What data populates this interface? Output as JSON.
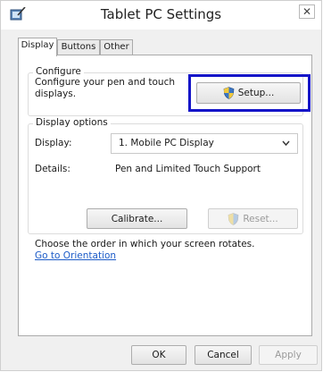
{
  "window": {
    "title": "Tablet PC Settings",
    "close_glyph": "✕"
  },
  "tabs": [
    {
      "label": "Display",
      "active": true
    },
    {
      "label": "Buttons",
      "active": false
    },
    {
      "label": "Other",
      "active": false
    }
  ],
  "configure": {
    "group_label": "Configure",
    "description_line1": "Configure your pen and touch",
    "description_line2": "displays.",
    "setup_button": "Setup..."
  },
  "display_options": {
    "group_label": "Display options",
    "display_label": "Display:",
    "display_value": "1. Mobile PC Display",
    "details_label": "Details:",
    "details_value": "Pen and Limited Touch Support",
    "calibrate_button": "Calibrate...",
    "reset_button": "Reset..."
  },
  "orientation": {
    "text": "Choose the order in which your screen rotates.",
    "link": "Go to Orientation"
  },
  "footer": {
    "ok": "OK",
    "cancel": "Cancel",
    "apply": "Apply"
  },
  "icons": {
    "window": "tablet-pen-icon",
    "uac": "uac-shield-icon"
  },
  "colors": {
    "highlight": "#1515c8",
    "link": "#1d5cc8"
  }
}
